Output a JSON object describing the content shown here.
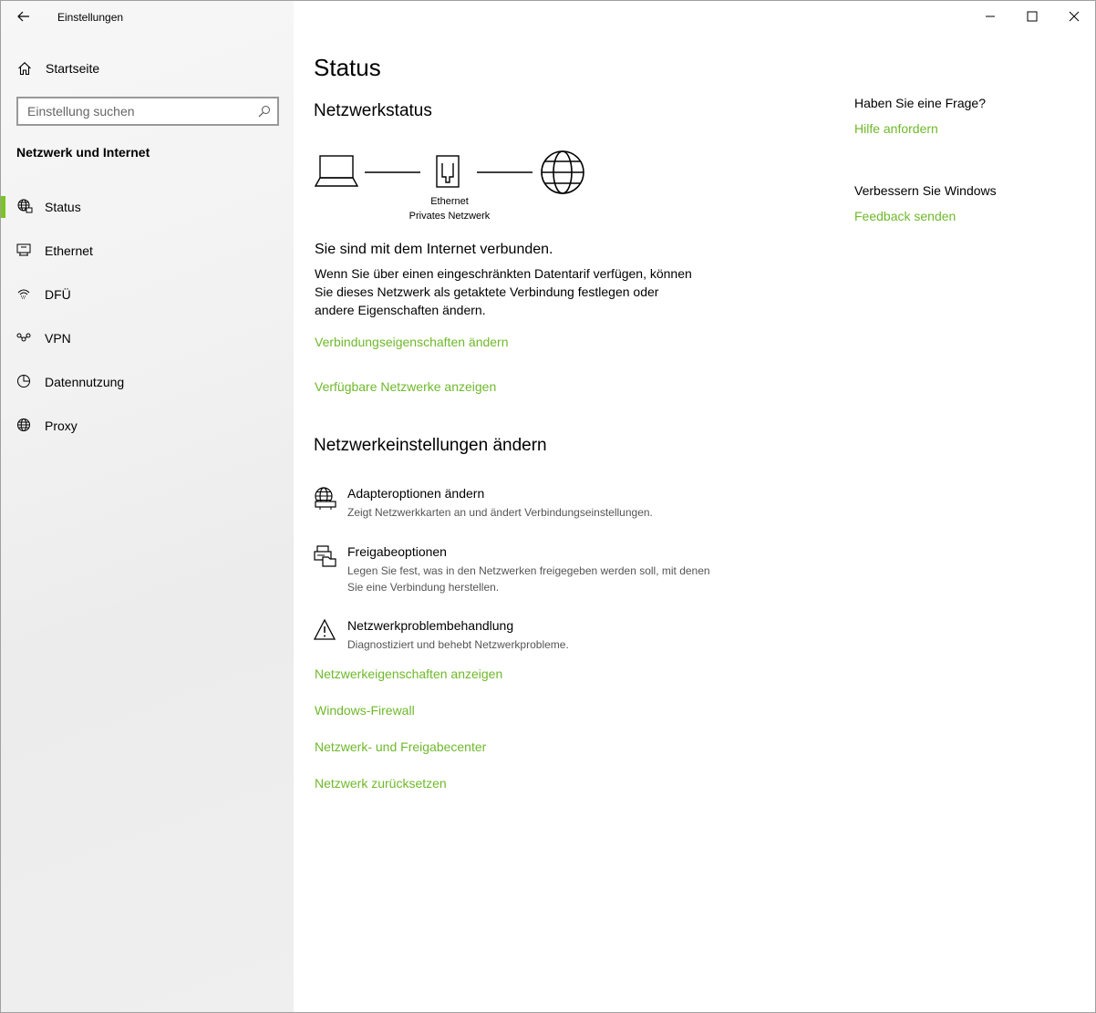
{
  "window": {
    "title": "Einstellungen"
  },
  "sidebar": {
    "home_label": "Startseite",
    "search_placeholder": "Einstellung suchen",
    "section_title": "Netzwerk und Internet",
    "items": [
      {
        "label": "Status",
        "icon": "globe-network-icon",
        "selected": true
      },
      {
        "label": "Ethernet",
        "icon": "ethernet-icon",
        "selected": false
      },
      {
        "label": "DFÜ",
        "icon": "dialup-icon",
        "selected": false
      },
      {
        "label": "VPN",
        "icon": "vpn-icon",
        "selected": false
      },
      {
        "label": "Datennutzung",
        "icon": "data-usage-icon",
        "selected": false
      },
      {
        "label": "Proxy",
        "icon": "globe-icon",
        "selected": false
      }
    ]
  },
  "main": {
    "title": "Status",
    "network_status_heading": "Netzwerkstatus",
    "diagram": {
      "adapter_name": "Ethernet",
      "network_profile": "Privates Netzwerk"
    },
    "connected_text": "Sie sind mit dem Internet verbunden.",
    "description": "Wenn Sie über einen eingeschränkten Datentarif verfügen, können Sie dieses Netzwerk als getaktete Verbindung festlegen oder andere Eigenschaften ändern.",
    "links_top": [
      "Verbindungseigenschaften ändern",
      "Verfügbare Netzwerke anzeigen"
    ],
    "change_settings_heading": "Netzwerkeinstellungen ändern",
    "options": [
      {
        "title": "Adapteroptionen ändern",
        "subtitle": "Zeigt Netzwerkkarten an und ändert Verbindungseinstellungen.",
        "icon": "adapter-icon"
      },
      {
        "title": "Freigabeoptionen",
        "subtitle": "Legen Sie fest, was in den Netzwerken freigegeben werden soll, mit denen Sie eine Verbindung herstellen.",
        "icon": "sharing-icon"
      },
      {
        "title": "Netzwerkproblembehandlung",
        "subtitle": "Diagnostiziert und behebt Netzwerkprobleme.",
        "icon": "warning-icon"
      }
    ],
    "links_bottom": [
      "Netzwerkeigenschaften anzeigen",
      "Windows-Firewall",
      "Netzwerk- und Freigabecenter",
      "Netzwerk zurücksetzen"
    ]
  },
  "aside": {
    "question_heading": "Haben Sie eine Frage?",
    "help_link": "Hilfe anfordern",
    "improve_heading": "Verbessern Sie Windows",
    "feedback_link": "Feedback senden"
  },
  "colors": {
    "accent": "#7cc423",
    "link": "#6fb92b"
  }
}
